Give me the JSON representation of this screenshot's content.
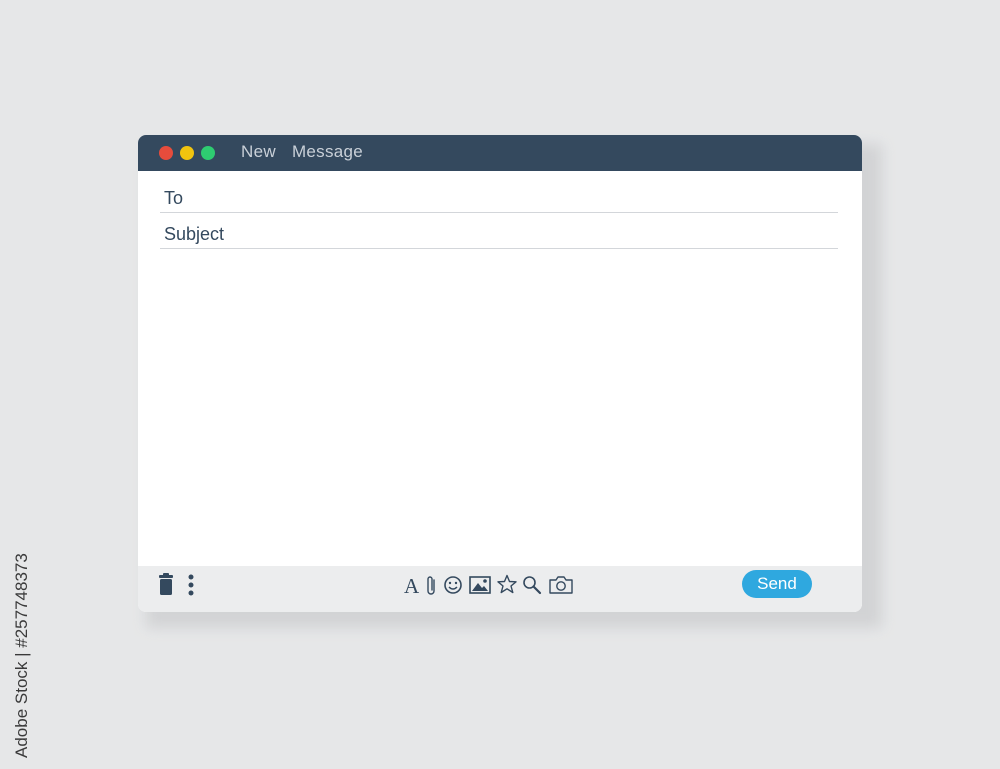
{
  "window": {
    "title": "New  Message",
    "traffic_lights": [
      {
        "name": "close",
        "color": "#e74c3c"
      },
      {
        "name": "minimize",
        "color": "#f1c40f"
      },
      {
        "name": "zoom",
        "color": "#2ecc71"
      }
    ]
  },
  "fields": {
    "to": {
      "label": "To",
      "value": ""
    },
    "subject": {
      "label": "Subject",
      "value": ""
    },
    "body": {
      "value": ""
    }
  },
  "toolbar": {
    "left_icons": [
      "trash-icon",
      "more-vertical-icon"
    ],
    "format_text_label": "A",
    "icons": [
      "text-format-icon",
      "attachment-icon",
      "emoji-icon",
      "image-icon",
      "star-icon",
      "search-icon",
      "camera-icon"
    ],
    "send_label": "Send"
  },
  "colors": {
    "titlebar": "#34495e",
    "send_button": "#2fa8df",
    "footer": "#ecedee",
    "background": "#e6e7e8"
  },
  "watermark": "Adobe Stock | #257748373"
}
